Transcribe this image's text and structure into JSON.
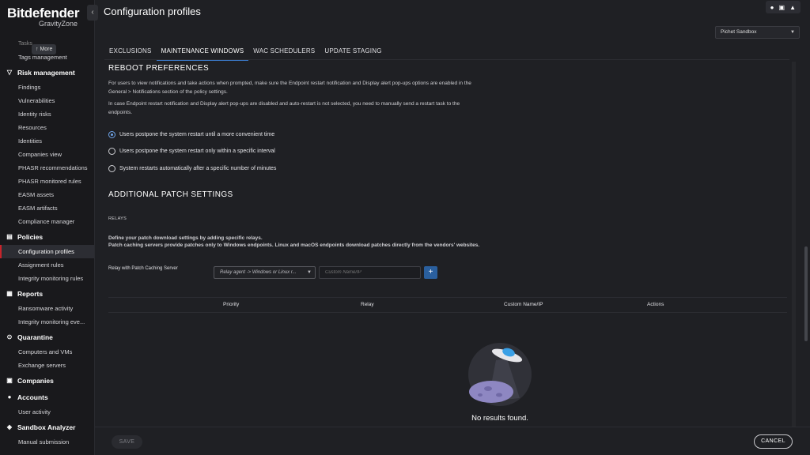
{
  "brand": {
    "name": "Bitdefender",
    "product": "GravityZone"
  },
  "sidebar": {
    "more_label": "↑ More",
    "cut_text": "Tasks",
    "top_items": [
      "Tags management"
    ],
    "groups": [
      {
        "label": "Risk management",
        "icon": "risk-icon",
        "items": [
          "Findings",
          "Vulnerabilities",
          "Identity risks",
          "Resources",
          "Identities",
          "Companies view",
          "PHASR recommendations",
          "PHASR monitored rules",
          "EASM assets",
          "EASM artifacts",
          "Compliance manager"
        ]
      },
      {
        "label": "Policies",
        "icon": "policies-icon",
        "items": [
          "Configuration profiles",
          "Assignment rules",
          "Integrity monitoring rules"
        ]
      },
      {
        "label": "Reports",
        "icon": "reports-icon",
        "items": [
          "Ransomware activity",
          "Integrity monitoring eve..."
        ]
      },
      {
        "label": "Quarantine",
        "icon": "quarantine-icon",
        "items": [
          "Computers and VMs",
          "Exchange servers"
        ]
      },
      {
        "label": "Companies",
        "icon": "companies-icon",
        "items": []
      },
      {
        "label": "Accounts",
        "icon": "accounts-icon",
        "items": [
          "User activity"
        ]
      },
      {
        "label": "Sandbox Analyzer",
        "icon": "sandbox-icon",
        "items": [
          "Manual submission"
        ]
      }
    ],
    "active_item": "Configuration profiles"
  },
  "header": {
    "title": "Configuration profiles"
  },
  "company_selector": {
    "value": "Pichet Sandbox"
  },
  "tabs": [
    "EXCLUSIONS",
    "MAINTENANCE WINDOWS",
    "WAC SCHEDULERS",
    "UPDATE STAGING"
  ],
  "active_tab": "MAINTENANCE WINDOWS",
  "reboot": {
    "title": "REBOOT PREFERENCES",
    "para1": "For users to view notifications and take actions when prompted, make sure the Endpoint restart notification and Display alert pop-ups options are enabled in the General > Notifications section of the policy settings.",
    "para2": "In case Endpoint restart notification and Display alert pop-ups are disabled and auto-restart is not selected, you need to manually send a restart task to the endpoints.",
    "options": [
      {
        "label": "Users postpone the system restart until a more convenient time",
        "checked": true
      },
      {
        "label": "Users postpone the system restart only within a specific interval",
        "checked": false
      },
      {
        "label": "System restarts automatically after a specific number of minutes",
        "checked": false
      }
    ]
  },
  "patch": {
    "title": "ADDITIONAL PATCH SETTINGS",
    "relays_label": "RELAYS",
    "desc1": "Define your patch download settings by adding specific relays.",
    "desc2": "Patch caching servers provide patches only to Windows endpoints. Linux and macOS endpoints download patches directly from the vendors' websites.",
    "relay_field_label": "Relay with Patch Caching Server",
    "relay_select_value": "Relay agent -> Windows or Linux r...",
    "custom_placeholder": "Custom Name/IP",
    "add_symbol": "+"
  },
  "table": {
    "columns": [
      "Priority",
      "Relay",
      "Custom Name/IP",
      "Actions"
    ],
    "empty_text": "No results found."
  },
  "footer": {
    "save": "SAVE",
    "cancel": "CANCEL"
  },
  "colors": {
    "accent": "#3a79c9",
    "active_marker": "#c8242b",
    "background": "#1f2024",
    "sidebar": "#19191c"
  }
}
